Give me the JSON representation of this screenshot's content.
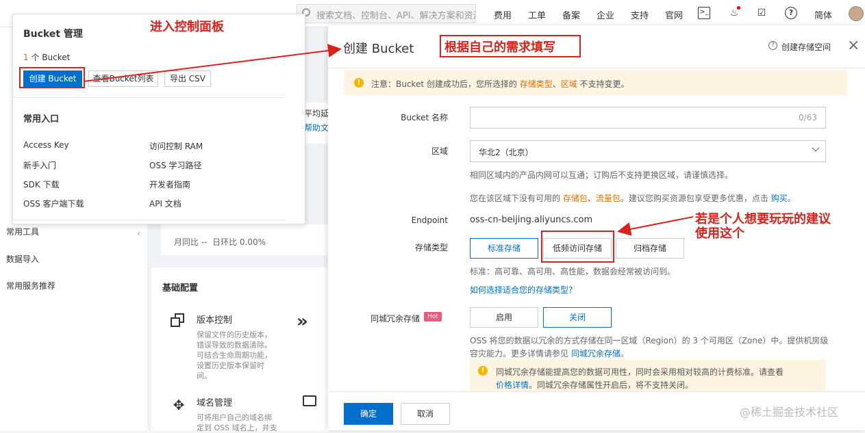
{
  "topbar": {
    "search_placeholder": "搜索文档、控制台、API、解决方案和资源",
    "nav": [
      "费用",
      "工单",
      "备案",
      "企业",
      "支持",
      "官网"
    ],
    "lang": "简体"
  },
  "left_nav": [
    "常用工具",
    "数据导入",
    "常用服务推荐"
  ],
  "middle": {
    "peek1": "平均延",
    "peek2": "帮助文",
    "stat": "月同比 --  日环比 0.00%",
    "config_title": "基础配置",
    "version_title": "版本控制",
    "version_desc": "保留文件的历史版本，错误导致的数据清除。可结合生命周期功能，设置历史版本保留时间。",
    "domain_title": "域名管理",
    "domain_desc": "可将用户自己的域名绑定到 OSS 域名上，并支"
  },
  "panel": {
    "title": "Bucket 管理",
    "count_num": "1",
    "count_text": " 个 Bucket",
    "create_btn": "创建 Bucket",
    "list_btn": "查看Bucket列表",
    "export_btn": "导出 CSV",
    "entry_title": "常用入口",
    "entries_left": [
      "Access Key",
      "新手入门",
      "SDK 下载",
      "OSS 客户端下载"
    ],
    "entries_right": [
      "访问控制 RAM",
      "OSS 学习路径",
      "开发者指南",
      "API 文档"
    ]
  },
  "annotations": {
    "enter_panel": "进入控制面板",
    "fill_as_needed": "根据自己的需求填写",
    "suggest_line1": "若是个人想要玩玩的建议",
    "suggest_line2": "使用这个",
    "arrow_color": "#d9221a"
  },
  "drawer": {
    "title": "创建 Bucket",
    "help_link": "创建存储空间",
    "notice_pre": "注意：Bucket 创建成功后，您所选择的 ",
    "notice_storage": "存储类型",
    "notice_sep": "、",
    "notice_region": "区域",
    "notice_post": " 不支持变更。",
    "name_label": "Bucket 名称",
    "name_counter": "0/63",
    "region_label": "区域",
    "region_value": "华北2（北京）",
    "region_help": "相同区域内的产品内网可以互通；订购后不支持更换区域，请谨慎选择。",
    "region_help2_pre": "您在该区域下没有可用的 ",
    "region_help2_storage": "存储包",
    "region_help2_sep": "、",
    "region_help2_traffic": "流量包",
    "region_help2_mid": "。建议您购买资源包享受更多优惠，点击 ",
    "region_help2_buy": "购买",
    "region_help2_end": "。",
    "endpoint_label": "Endpoint",
    "endpoint_value": "oss-cn-beijing.aliyuncs.com",
    "storage_label": "存储类型",
    "storage_options": [
      "标准存储",
      "低频访问存储",
      "归档存储"
    ],
    "storage_help": "标准：高可靠、高可用、高性能，数据会经常被访问到。",
    "storage_link": "如何选择适合您的存储类型?",
    "redundancy_label": "同城冗余存储",
    "hot": "Hot",
    "redundancy_options": [
      "启用",
      "关闭"
    ],
    "redundancy_help1": "OSS 将您的数据以冗余的方式存储在同一区域（Region）的 3 个可用区（Zone）中。提供机房级",
    "redundancy_help2_pre": "容灾能力。更多详情请参见 ",
    "redundancy_help2_link": "同城冗余存储",
    "redundancy_help2_end": "。",
    "redundancy_notice1": "同城冗余存储能提高您的数据可用性，同时会采用相对较高的计费标准。请查看",
    "redundancy_notice2_link": "价格详情",
    "redundancy_notice2_post": "。同城冗余存储属性开启后，将不支持关闭。",
    "ok": "确定",
    "cancel": "取消"
  },
  "watermark": "@稀土掘金技术社区"
}
